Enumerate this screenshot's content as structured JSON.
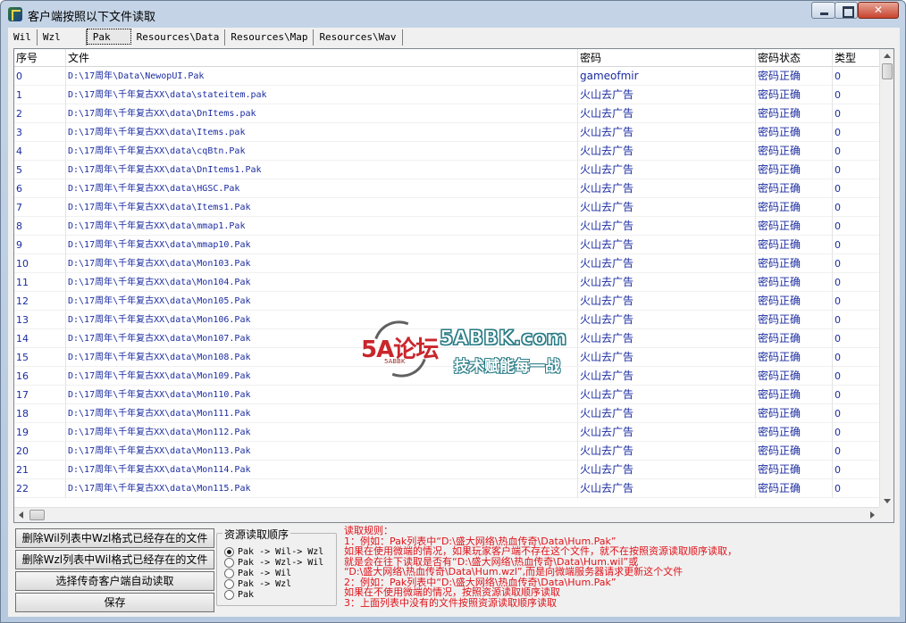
{
  "window": {
    "title": "客户端按照以下文件读取"
  },
  "tabs": [
    {
      "label": "Wil"
    },
    {
      "label": "Wzl"
    },
    {
      "label": "Pak"
    },
    {
      "label": "Resources\\Data"
    },
    {
      "label": "Resources\\Map"
    },
    {
      "label": "Resources\\Wav"
    }
  ],
  "table": {
    "headers": [
      "序号",
      "文件",
      "密码",
      "密码状态",
      "类型"
    ],
    "rows": [
      {
        "idx": "0",
        "file": "D:\\17周年\\Data\\NewopUI.Pak",
        "password": "gameofmir",
        "status": "密码正确",
        "type": "0"
      },
      {
        "idx": "1",
        "file": "D:\\17周年\\千年复古XX\\data\\stateitem.pak",
        "password": "火山去广告",
        "status": "密码正确",
        "type": "0"
      },
      {
        "idx": "2",
        "file": "D:\\17周年\\千年复古XX\\data\\DnItems.pak",
        "password": "火山去广告",
        "status": "密码正确",
        "type": "0"
      },
      {
        "idx": "3",
        "file": "D:\\17周年\\千年复古XX\\data\\Items.pak",
        "password": "火山去广告",
        "status": "密码正确",
        "type": "0"
      },
      {
        "idx": "4",
        "file": "D:\\17周年\\千年复古XX\\data\\cqBtn.Pak",
        "password": "火山去广告",
        "status": "密码正确",
        "type": "0"
      },
      {
        "idx": "5",
        "file": "D:\\17周年\\千年复古XX\\data\\DnItems1.Pak",
        "password": "火山去广告",
        "status": "密码正确",
        "type": "0"
      },
      {
        "idx": "6",
        "file": "D:\\17周年\\千年复古XX\\data\\HGSC.Pak",
        "password": "火山去广告",
        "status": "密码正确",
        "type": "0"
      },
      {
        "idx": "7",
        "file": "D:\\17周年\\千年复古XX\\data\\Items1.Pak",
        "password": "火山去广告",
        "status": "密码正确",
        "type": "0"
      },
      {
        "idx": "8",
        "file": "D:\\17周年\\千年复古XX\\data\\mmap1.Pak",
        "password": "火山去广告",
        "status": "密码正确",
        "type": "0"
      },
      {
        "idx": "9",
        "file": "D:\\17周年\\千年复古XX\\data\\mmap10.Pak",
        "password": "火山去广告",
        "status": "密码正确",
        "type": "0"
      },
      {
        "idx": "10",
        "file": "D:\\17周年\\千年复古XX\\data\\Mon103.Pak",
        "password": "火山去广告",
        "status": "密码正确",
        "type": "0"
      },
      {
        "idx": "11",
        "file": "D:\\17周年\\千年复古XX\\data\\Mon104.Pak",
        "password": "火山去广告",
        "status": "密码正确",
        "type": "0"
      },
      {
        "idx": "12",
        "file": "D:\\17周年\\千年复古XX\\data\\Mon105.Pak",
        "password": "火山去广告",
        "status": "密码正确",
        "type": "0"
      },
      {
        "idx": "13",
        "file": "D:\\17周年\\千年复古XX\\data\\Mon106.Pak",
        "password": "火山去广告",
        "status": "密码正确",
        "type": "0"
      },
      {
        "idx": "14",
        "file": "D:\\17周年\\千年复古XX\\data\\Mon107.Pak",
        "password": "火山去广告",
        "status": "密码正确",
        "type": "0"
      },
      {
        "idx": "15",
        "file": "D:\\17周年\\千年复古XX\\data\\Mon108.Pak",
        "password": "火山去广告",
        "status": "密码正确",
        "type": "0"
      },
      {
        "idx": "16",
        "file": "D:\\17周年\\千年复古XX\\data\\Mon109.Pak",
        "password": "火山去广告",
        "status": "密码正确",
        "type": "0"
      },
      {
        "idx": "17",
        "file": "D:\\17周年\\千年复古XX\\data\\Mon110.Pak",
        "password": "火山去广告",
        "status": "密码正确",
        "type": "0"
      },
      {
        "idx": "18",
        "file": "D:\\17周年\\千年复古XX\\data\\Mon111.Pak",
        "password": "火山去广告",
        "status": "密码正确",
        "type": "0"
      },
      {
        "idx": "19",
        "file": "D:\\17周年\\千年复古XX\\data\\Mon112.Pak",
        "password": "火山去广告",
        "status": "密码正确",
        "type": "0"
      },
      {
        "idx": "20",
        "file": "D:\\17周年\\千年复古XX\\data\\Mon113.Pak",
        "password": "火山去广告",
        "status": "密码正确",
        "type": "0"
      },
      {
        "idx": "21",
        "file": "D:\\17周年\\千年复古XX\\data\\Mon114.Pak",
        "password": "火山去广告",
        "status": "密码正确",
        "type": "0"
      },
      {
        "idx": "22",
        "file": "D:\\17周年\\千年复古XX\\data\\Mon115.Pak",
        "password": "火山去广告",
        "status": "密码正确",
        "type": "0"
      }
    ]
  },
  "watermark": {
    "logo": "5A论坛",
    "sub": "5ABBK",
    "domain": "5ABBK.com",
    "slogan": "技术赋能每一战"
  },
  "buttons": {
    "delete_wil": "删除Wil列表中Wzl格式已经存在的文件",
    "delete_wzl": "删除Wzl列表中Wil格式已经存在的文件",
    "auto_read": "选择传奇客户端自动读取",
    "save": "保存"
  },
  "order_group": {
    "title": "资源读取顺序",
    "options": [
      {
        "label": "Pak -> Wil-> Wzl",
        "checked": true
      },
      {
        "label": "Pak -> Wzl-> Wil",
        "checked": false
      },
      {
        "label": "Pak -> Wil",
        "checked": false
      },
      {
        "label": "Pak -> Wzl",
        "checked": false
      },
      {
        "label": "Pak",
        "checked": false
      }
    ]
  },
  "rules": [
    "读取规则：",
    "1：例如：Pak列表中“D:\\盛大网络\\热血传奇\\Data\\Hum.Pak”",
    "     如果在使用微端的情况，如果玩家客户端不存在这个文件，就不在按照资源读取顺序读取，",
    "     就是会在往下读取是否有“D:\\盛大网络\\热血传奇\\Data\\Hum.wil”或",
    "     “D:\\盛大网络\\热血传奇\\Data\\Hum.wzl”,而是向微端服务器请求更新这个文件",
    "2：例如：Pak列表中“D:\\盛大网络\\热血传奇\\Data\\Hum.Pak”",
    "     如果在不使用微端的情况，按照资源读取顺序读取",
    "3：上面列表中没有的文件按照资源读取顺序读取"
  ],
  "colors": {
    "cell_text": "#1b2ca0",
    "rules_text": "#e0131a"
  }
}
